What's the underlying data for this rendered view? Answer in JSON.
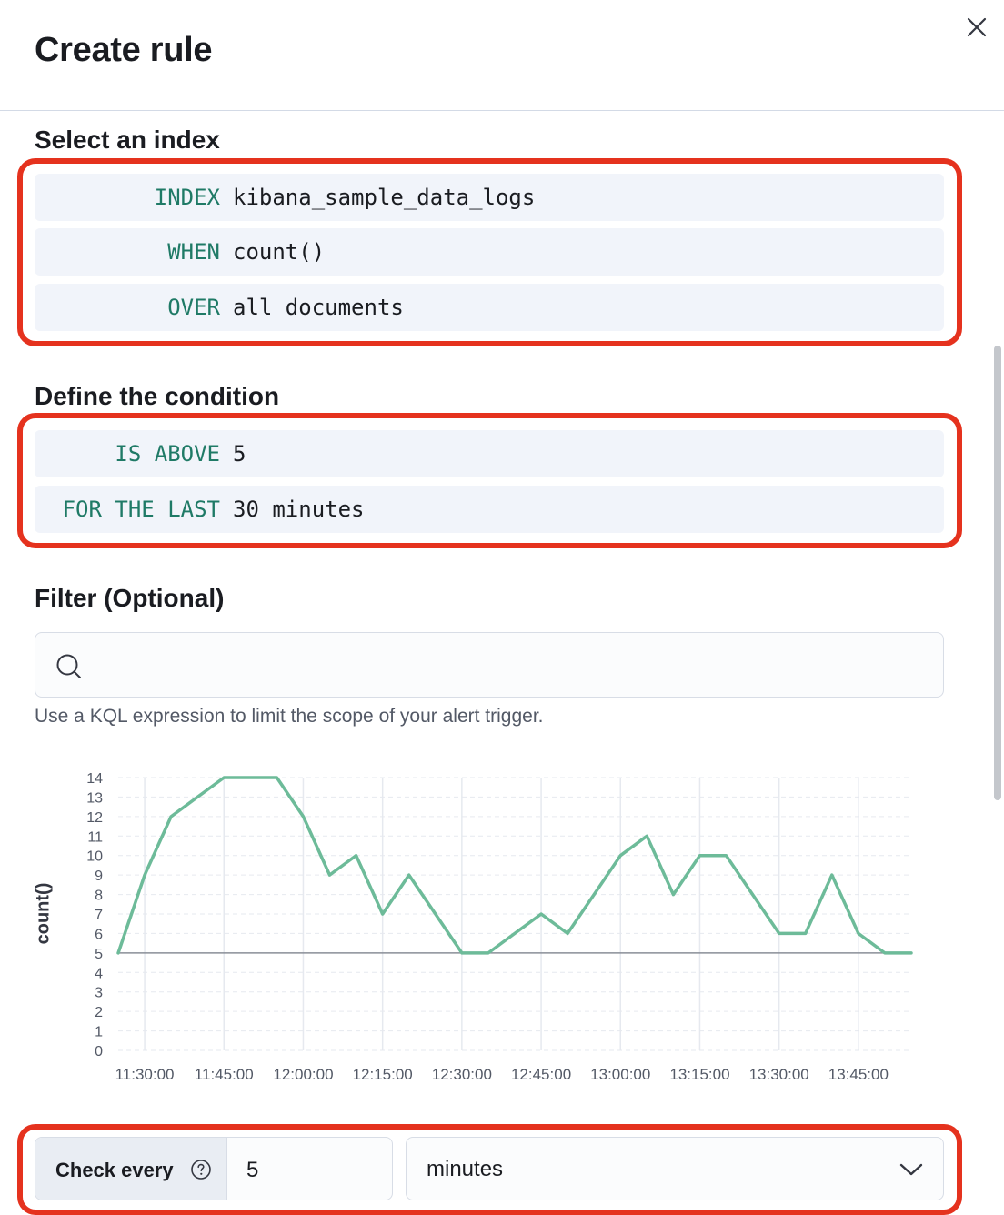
{
  "flyout": {
    "title": "Create rule",
    "close_label": "close"
  },
  "index_section": {
    "title": "Select an index",
    "rows": [
      {
        "keyword": "INDEX",
        "value": "kibana_sample_data_logs"
      },
      {
        "keyword": "WHEN",
        "value": "count()"
      },
      {
        "keyword": "OVER",
        "value": "all documents"
      }
    ]
  },
  "condition_section": {
    "title": "Define the condition",
    "rows": [
      {
        "keyword": "IS ABOVE",
        "value": "5"
      },
      {
        "keyword": "FOR THE LAST",
        "value": "30 minutes"
      }
    ]
  },
  "filter_section": {
    "title": "Filter (Optional)",
    "value": "",
    "help": "Use a KQL expression to limit the scope of your alert trigger."
  },
  "chart_data": {
    "type": "line",
    "ylabel": "count()",
    "xlabel": "",
    "ylim": [
      0,
      14
    ],
    "yticks": [
      0,
      1,
      2,
      3,
      4,
      5,
      6,
      7,
      8,
      9,
      10,
      11,
      12,
      13,
      14
    ],
    "xlim": [
      "11:25:00",
      "13:55:00"
    ],
    "xticks": [
      "11:30:00",
      "11:45:00",
      "12:00:00",
      "12:15:00",
      "12:30:00",
      "12:45:00",
      "13:00:00",
      "13:15:00",
      "13:30:00",
      "13:45:00"
    ],
    "threshold": 5,
    "grid": true,
    "series": [
      {
        "color": "#6dbb99",
        "points": [
          [
            "11:25:00",
            5
          ],
          [
            "11:30:00",
            9
          ],
          [
            "11:35:00",
            12
          ],
          [
            "11:40:00",
            13
          ],
          [
            "11:45:00",
            14
          ],
          [
            "11:50:00",
            14
          ],
          [
            "11:55:00",
            14
          ],
          [
            "12:00:00",
            12
          ],
          [
            "12:05:00",
            9
          ],
          [
            "12:10:00",
            10
          ],
          [
            "12:15:00",
            7
          ],
          [
            "12:20:00",
            9
          ],
          [
            "12:25:00",
            7
          ],
          [
            "12:30:00",
            5
          ],
          [
            "12:35:00",
            5
          ],
          [
            "12:40:00",
            6
          ],
          [
            "12:45:00",
            7
          ],
          [
            "12:50:00",
            6
          ],
          [
            "12:55:00",
            8
          ],
          [
            "13:00:00",
            10
          ],
          [
            "13:05:00",
            11
          ],
          [
            "13:10:00",
            8
          ],
          [
            "13:15:00",
            10
          ],
          [
            "13:20:00",
            10
          ],
          [
            "13:25:00",
            8
          ],
          [
            "13:30:00",
            6
          ],
          [
            "13:35:00",
            6
          ],
          [
            "13:40:00",
            9
          ],
          [
            "13:45:00",
            6
          ],
          [
            "13:50:00",
            5
          ],
          [
            "13:55:00",
            5
          ]
        ]
      }
    ]
  },
  "schedule": {
    "label": "Check every",
    "value": "5",
    "unit": "minutes"
  },
  "colors": {
    "keyword": "#1f7a66",
    "highlight": "#e5321e",
    "line": "#6dbb99"
  }
}
